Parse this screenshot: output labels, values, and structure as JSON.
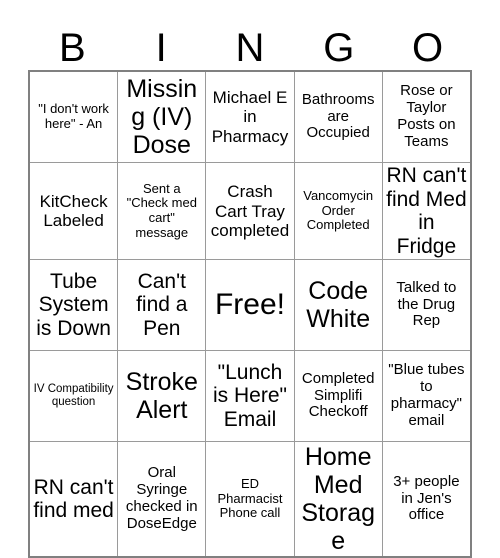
{
  "card": {
    "title_letters": [
      "B",
      "I",
      "N",
      "G",
      "O"
    ],
    "free_space_label": "Free!",
    "rows": [
      [
        {
          "text": "\"I don't work here\" - An",
          "size": "sm"
        },
        {
          "text": "Missing (IV) Dose",
          "size": "xxl"
        },
        {
          "text": "Michael E in Pharmacy",
          "size": "lg"
        },
        {
          "text": "Bathrooms are Occupied",
          "size": "md"
        },
        {
          "text": "Rose or Taylor Posts on Teams",
          "size": "md"
        }
      ],
      [
        {
          "text": "KitCheck Labeled",
          "size": "lg"
        },
        {
          "text": "Sent a \"Check med cart\" message",
          "size": "sm"
        },
        {
          "text": "Crash Cart Tray completed",
          "size": "lg"
        },
        {
          "text": "Vancomycin Order Completed",
          "size": "sm"
        },
        {
          "text": "RN can't find Med in Fridge",
          "size": "xl"
        }
      ],
      [
        {
          "text": "Tube System is Down",
          "size": "xl"
        },
        {
          "text": "Can't find a Pen",
          "size": "xl"
        },
        {
          "text": "Free!",
          "size": "free"
        },
        {
          "text": "Code White",
          "size": "xxl"
        },
        {
          "text": "Talked to the Drug Rep",
          "size": "md"
        }
      ],
      [
        {
          "text": "IV Compatibility question",
          "size": "xs"
        },
        {
          "text": "Stroke Alert",
          "size": "xxl"
        },
        {
          "text": "\"Lunch is Here\" Email",
          "size": "xl"
        },
        {
          "text": "Completed Simplifi Checkoff",
          "size": "md"
        },
        {
          "text": "\"Blue tubes to pharmacy\" email",
          "size": "md"
        }
      ],
      [
        {
          "text": "RN can't find med",
          "size": "xl"
        },
        {
          "text": "Oral Syringe checked in DoseEdge",
          "size": "md"
        },
        {
          "text": "ED Pharmacist Phone call",
          "size": "sm"
        },
        {
          "text": "Home Med Storage",
          "size": "xxl"
        },
        {
          "text": "3+ people in Jen's office",
          "size": "md"
        }
      ]
    ]
  },
  "colors": {
    "text": "#000000",
    "grid_line": "#9a9a9a",
    "outer_border": "#808080",
    "background": "#ffffff"
  }
}
